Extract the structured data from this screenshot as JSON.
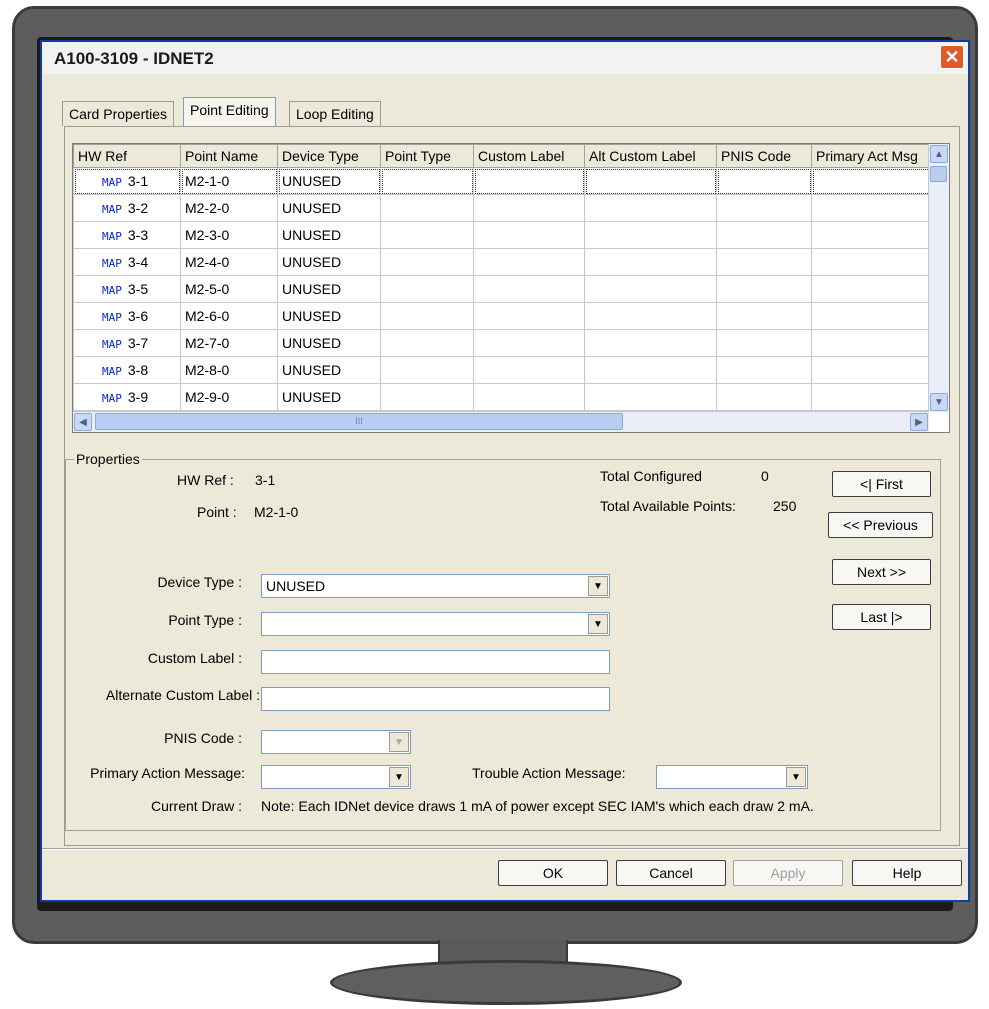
{
  "window": {
    "title": "A100-3109 - IDNET2",
    "close_glyph": "✕"
  },
  "tabs": [
    "Card Properties",
    "Point Editing",
    "Loop Editing"
  ],
  "grid": {
    "columns": [
      "HW Ref",
      "Point Name",
      "Device Type",
      "Point Type",
      "Custom Label",
      "Alt Custom Label",
      "PNIS Code",
      "Primary Act Msg"
    ],
    "map_tag": "MAP",
    "rows": [
      {
        "hw": "3-1",
        "name": "M2-1-0",
        "device": "UNUSED"
      },
      {
        "hw": "3-2",
        "name": "M2-2-0",
        "device": "UNUSED"
      },
      {
        "hw": "3-3",
        "name": "M2-3-0",
        "device": "UNUSED"
      },
      {
        "hw": "3-4",
        "name": "M2-4-0",
        "device": "UNUSED"
      },
      {
        "hw": "3-5",
        "name": "M2-5-0",
        "device": "UNUSED"
      },
      {
        "hw": "3-6",
        "name": "M2-6-0",
        "device": "UNUSED"
      },
      {
        "hw": "3-7",
        "name": "M2-7-0",
        "device": "UNUSED"
      },
      {
        "hw": "3-8",
        "name": "M2-8-0",
        "device": "UNUSED"
      },
      {
        "hw": "3-9",
        "name": "M2-9-0",
        "device": "UNUSED"
      }
    ],
    "hscroll_grip": "III"
  },
  "properties": {
    "legend": "Properties",
    "hw_ref_label": "HW Ref :",
    "hw_ref_value": "3-1",
    "point_label": "Point :",
    "point_value": "M2-1-0",
    "total_configured_label": "Total Configured",
    "total_configured_value": "0",
    "total_available_label": "Total Available Points:",
    "total_available_value": "250",
    "device_type_label": "Device Type :",
    "device_type_value": "UNUSED",
    "point_type_label": "Point Type :",
    "point_type_value": "",
    "custom_label_label": "Custom Label :",
    "custom_label_value": "",
    "alt_custom_label_label": "Alternate Custom Label :",
    "alt_custom_label_value": "",
    "pnis_label": "PNIS Code :",
    "pnis_value": "",
    "primary_action_label": "Primary Action Message:",
    "primary_action_value": "",
    "trouble_action_label": "Trouble Action Message:",
    "trouble_action_value": "",
    "current_draw_label": "Current Draw :",
    "current_draw_note": "Note: Each IDNet device draws 1 mA of power except SEC IAM's which each draw 2 mA."
  },
  "nav": {
    "first": "<| First",
    "previous": "<< Previous",
    "next": "Next >>",
    "last": "Last |>"
  },
  "footer": {
    "ok": "OK",
    "cancel": "Cancel",
    "apply": "Apply",
    "help": "Help"
  }
}
